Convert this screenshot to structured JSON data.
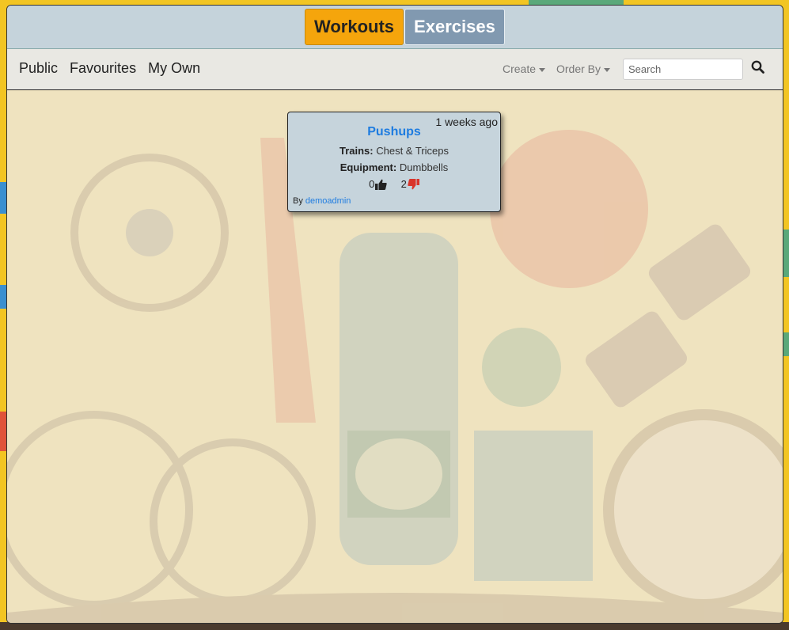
{
  "header": {
    "tabs": [
      {
        "label": "Workouts",
        "active": true
      },
      {
        "label": "Exercises",
        "active": false
      }
    ]
  },
  "nav": {
    "links": [
      "Public",
      "Favourites",
      "My Own"
    ],
    "create_label": "Create",
    "orderby_label": "Order By",
    "search_placeholder": "Search",
    "search_icon": "search-icon"
  },
  "card": {
    "time": "1 weeks ago",
    "title": "Pushups",
    "trains_label": "Trains:",
    "trains_value": "Chest & Triceps",
    "equipment_label": "Equipment:",
    "equipment_value": "Dumbbells",
    "likes": "0",
    "dislikes": "2",
    "by_label": "By",
    "author": "demoadmin"
  },
  "colors": {
    "accent_workouts": "#f5a50c",
    "exercises_tab": "#8199b0",
    "link": "#1e7ce0",
    "dislike": "#d9342b"
  }
}
